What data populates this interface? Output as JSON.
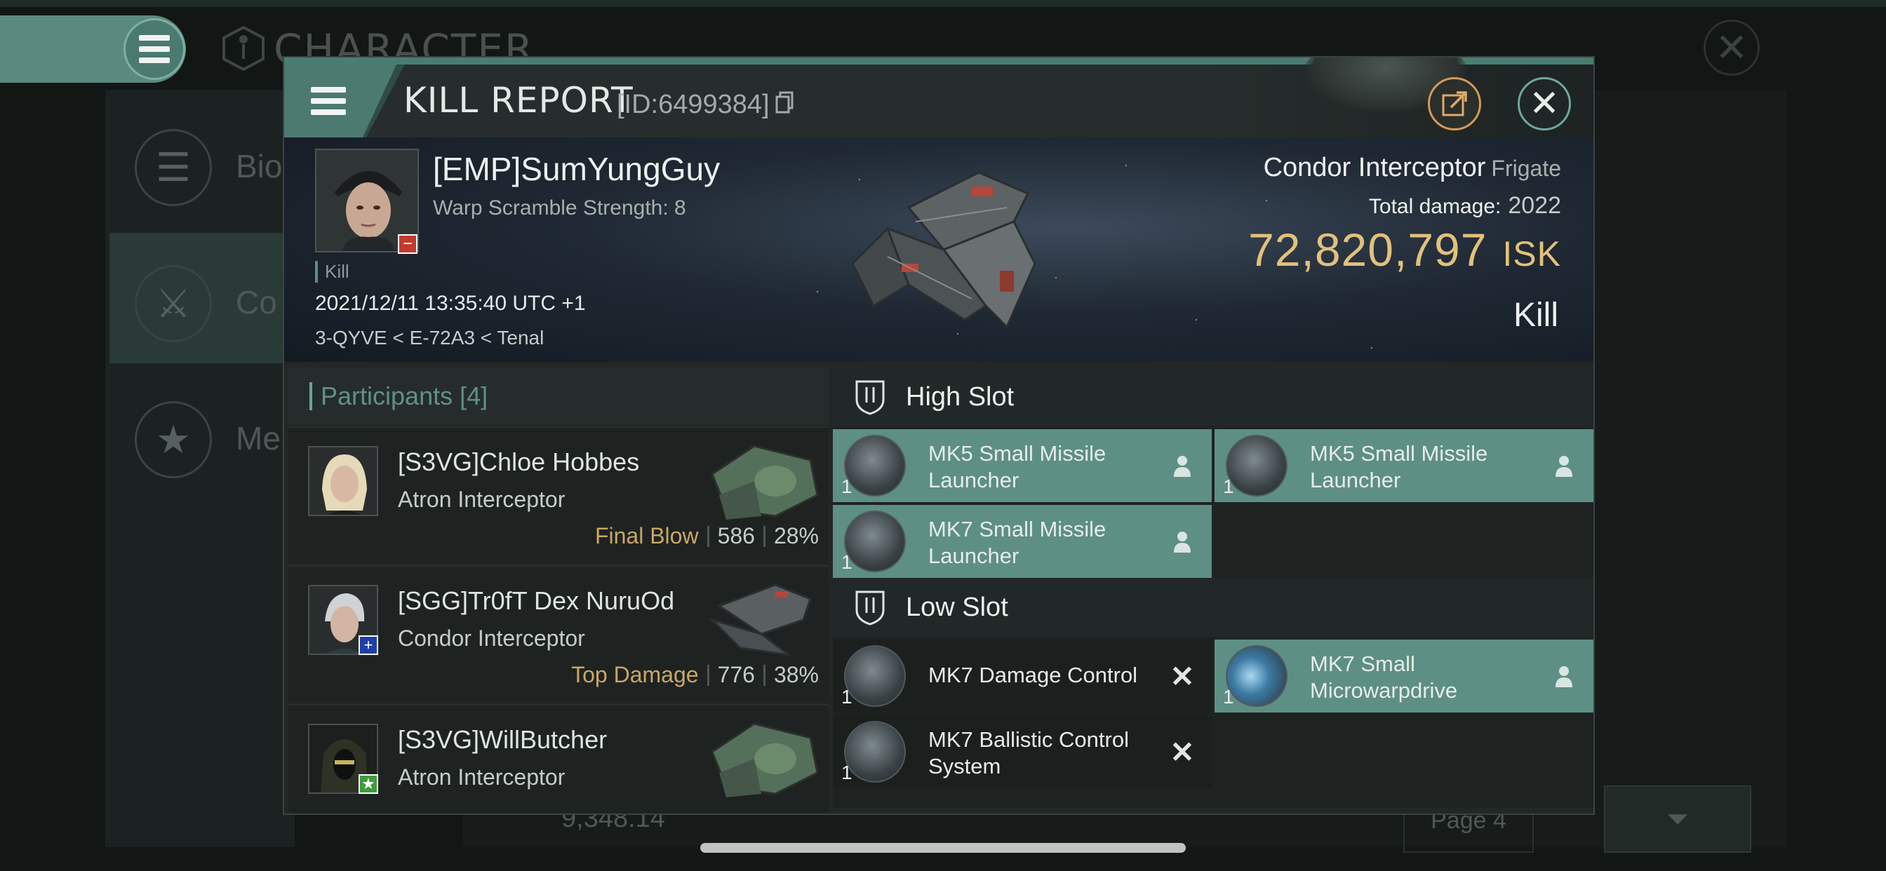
{
  "background": {
    "screen_title": "CHARACTER",
    "sidebar_items": [
      {
        "label": "Bio",
        "icon": "list-icon"
      },
      {
        "label": "Co",
        "icon": "crossed-swords-icon"
      },
      {
        "label": "Me",
        "icon": "star-badge-icon"
      }
    ],
    "isk_value": "9,348.14",
    "page_label": "Page 4"
  },
  "modal": {
    "title": "KILL REPORT",
    "id_label": "[ID:6499384]",
    "victim": {
      "name": "[EMP]SumYungGuy",
      "warp_scramble": "Warp Scramble Strength: 8",
      "kill_tag": "Kill",
      "datetime": "2021/12/11 13:35:40 UTC +1",
      "location": "3-QYVE < E-72A3 < Tenal"
    },
    "ship": {
      "name": "Condor Interceptor",
      "class": "Frigate",
      "total_damage_label": "Total damage:",
      "total_damage": "2022",
      "isk_value": "72,820,797",
      "isk_unit": "ISK",
      "result": "Kill"
    },
    "participants": {
      "label": "Participants",
      "count": "[4]",
      "rows": [
        {
          "name": "[S3VG]Chloe Hobbes",
          "ship": "Atron Interceptor",
          "tag": "Final Blow",
          "damage": "586",
          "percent": "28%",
          "badge_color": "",
          "hull_color": "#6a8a6a"
        },
        {
          "name": "[SGG]Tr0fT Dex NuruOd",
          "ship": "Condor Interceptor",
          "tag": "Top Damage",
          "damage": "776",
          "percent": "38%",
          "badge_color": "#1f3fa8",
          "hull_color": "#8b5d55"
        },
        {
          "name": "[S3VG]WillButcher",
          "ship": "Atron Interceptor",
          "tag": "",
          "damage": "",
          "percent": "",
          "badge_color": "#3f9a3f",
          "hull_color": "#6a8a6a"
        }
      ]
    },
    "high_slot": {
      "label": "High Slot",
      "modules": [
        {
          "name": "MK5 Small Missile Launcher",
          "qty": "1",
          "state": "fitted"
        },
        {
          "name": "MK5 Small Missile Launcher",
          "qty": "1",
          "state": "fitted"
        },
        {
          "name": "MK7 Small Missile Launcher",
          "qty": "1",
          "state": "fitted"
        }
      ]
    },
    "low_slot": {
      "label": "Low Slot",
      "modules": [
        {
          "name": "MK7 Damage Control",
          "qty": "1",
          "state": "destroyed"
        },
        {
          "name": "MK7 Small Microwarpdrive",
          "qty": "1",
          "state": "fitted"
        },
        {
          "name": "MK7 Ballistic Control System",
          "qty": "1",
          "state": "destroyed"
        }
      ]
    }
  },
  "colors": {
    "accent": "#5e8f84",
    "isk_gold": "#e2c17b",
    "tag_gold": "#c9a766",
    "loss_red": "#c23b2f"
  }
}
